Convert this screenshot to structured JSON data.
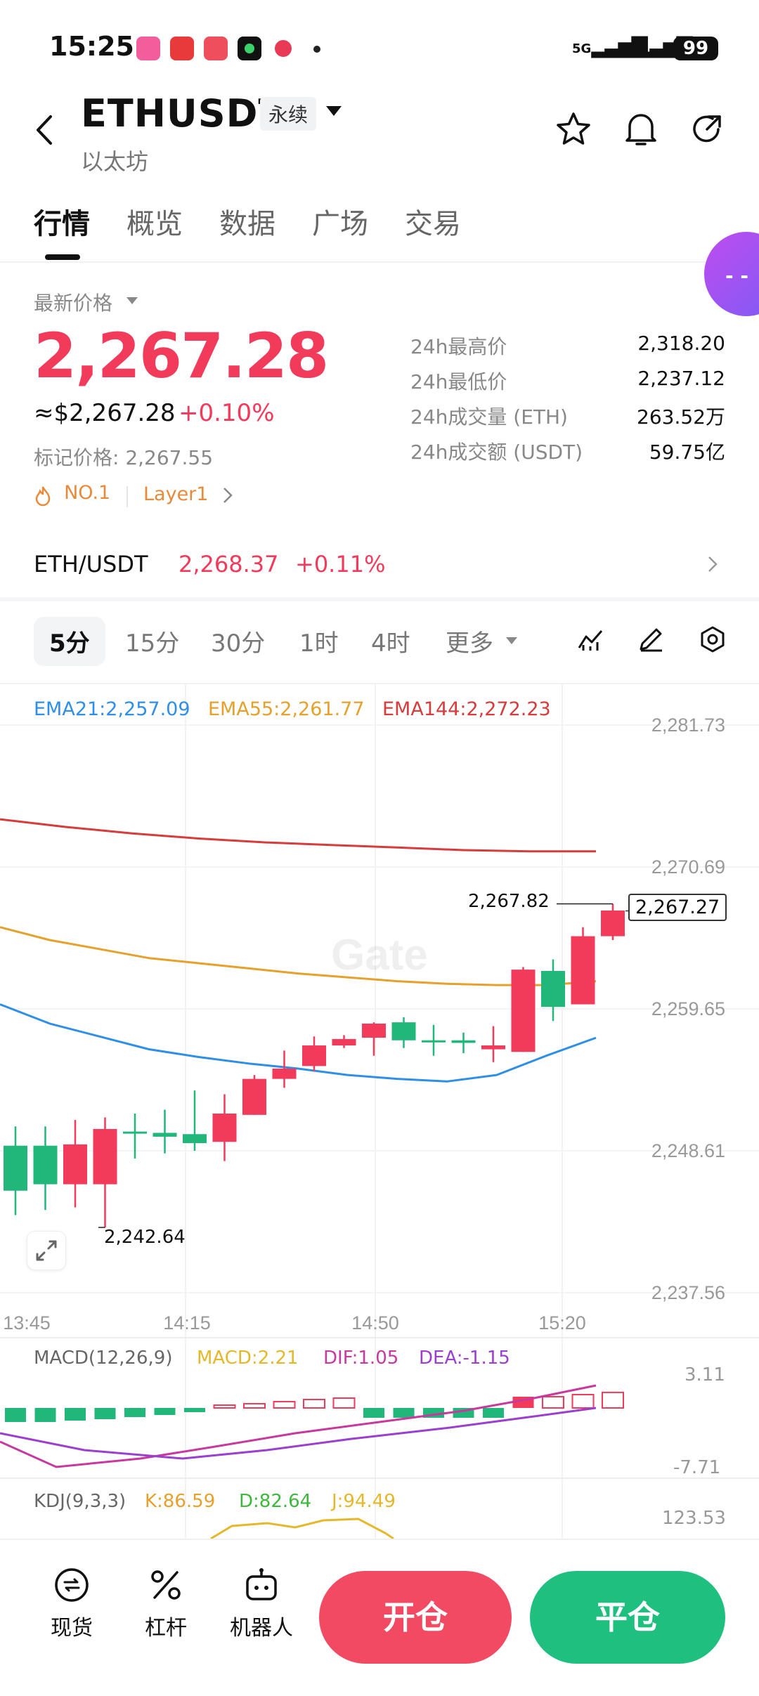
{
  "status": {
    "time": "15:25",
    "battery": "99",
    "net1": "5G",
    "net2": "5G"
  },
  "header": {
    "symbol": "ETHUSDT",
    "contract_type": "永续",
    "subtitle": "以太坊"
  },
  "tabs": [
    {
      "label": "行情",
      "active": true
    },
    {
      "label": "概览"
    },
    {
      "label": "数据"
    },
    {
      "label": "广场"
    },
    {
      "label": "交易"
    }
  ],
  "ticker": {
    "price_label": "最新价格",
    "last_price": "2,267.28",
    "usd_equiv": "≈$2,267.28",
    "change": "+0.10%",
    "mark_price": "标记价格: 2,267.55",
    "chip_rank": "NO.1",
    "chip_category": "Layer1",
    "stats": [
      {
        "label": "24h最高价",
        "value": "2,318.20"
      },
      {
        "label": "24h最低价",
        "value": "2,237.12"
      },
      {
        "label": "24h成交量 (ETH)",
        "value": "263.52万"
      },
      {
        "label": "24h成交额 (USDT)",
        "value": "59.75亿"
      }
    ]
  },
  "spot_pair": {
    "pair": "ETH/USDT",
    "price": "2,268.37",
    "change": "+0.11%"
  },
  "periods": [
    "5分",
    "15分",
    "30分",
    "1时",
    "4时"
  ],
  "periods_more": "更多",
  "active_period": "5分",
  "watermark": "Gate",
  "kline": {
    "ema21": "EMA21:2,257.09",
    "ema55": "EMA55:2,261.77",
    "ema144": "EMA144:2,272.23",
    "high_marker": "2,267.82",
    "low_marker": "2,242.64",
    "current_tag": "2,267.27",
    "colors": {
      "up": "#21b77a",
      "down": "#f23a5b",
      "ema21": "#2f8ee6",
      "ema55": "#e5a12b",
      "ema144": "#d63c3c"
    }
  },
  "macd": {
    "title": "MACD(12,26,9)",
    "macd": "MACD:2.21",
    "dif": "DIF:1.05",
    "dea": "DEA:-1.15",
    "ymax": "3.11",
    "ymin": "-7.71"
  },
  "kdj": {
    "title": "KDJ(9,3,3)",
    "k": "K:86.59",
    "d": "D:82.64",
    "j": "J:94.49",
    "ymax": "123.53"
  },
  "chart_data": {
    "type": "candlestick",
    "yticks": [
      "2,281.73",
      "2,270.69",
      "2,259.65",
      "2,248.61",
      "2,237.56"
    ],
    "xticks": [
      "13:45",
      "14:15",
      "14:50",
      "15:20"
    ],
    "candles": [
      {
        "o": 2245.5,
        "c": 2249.0,
        "h": 2250.5,
        "l": 2243.6
      },
      {
        "o": 2246.0,
        "c": 2249.0,
        "h": 2250.5,
        "l": 2244.0
      },
      {
        "o": 2249.1,
        "c": 2246.0,
        "h": 2251.0,
        "l": 2244.2
      },
      {
        "o": 2250.3,
        "c": 2246.0,
        "h": 2251.2,
        "l": 2242.64
      },
      {
        "o": 2250.0,
        "c": 2250.1,
        "h": 2251.5,
        "l": 2248.0
      },
      {
        "o": 2249.7,
        "c": 2250.0,
        "h": 2251.8,
        "l": 2248.4
      },
      {
        "o": 2249.2,
        "c": 2249.9,
        "h": 2253.3,
        "l": 2248.6
      },
      {
        "o": 2251.5,
        "c": 2249.3,
        "h": 2253.0,
        "l": 2247.8
      },
      {
        "o": 2254.2,
        "c": 2251.4,
        "h": 2254.5,
        "l": 2251.4
      },
      {
        "o": 2255.0,
        "c": 2254.2,
        "h": 2256.4,
        "l": 2253.5
      },
      {
        "o": 2256.8,
        "c": 2255.2,
        "h": 2257.5,
        "l": 2254.8
      },
      {
        "o": 2257.3,
        "c": 2256.8,
        "h": 2257.6,
        "l": 2256.6
      },
      {
        "o": 2258.5,
        "c": 2257.4,
        "h": 2258.6,
        "l": 2256.0
      },
      {
        "o": 2257.2,
        "c": 2258.6,
        "h": 2259.0,
        "l": 2256.6
      },
      {
        "o": 2257.2,
        "c": 2257.2,
        "h": 2258.4,
        "l": 2256.0
      },
      {
        "o": 2257.0,
        "c": 2257.2,
        "h": 2257.8,
        "l": 2256.2
      },
      {
        "o": 2256.8,
        "c": 2256.5,
        "h": 2258.3,
        "l": 2255.5
      },
      {
        "o": 2262.7,
        "c": 2256.3,
        "h": 2262.9,
        "l": 2256.3
      },
      {
        "o": 2259.8,
        "c": 2262.6,
        "h": 2263.5,
        "l": 2258.7
      },
      {
        "o": 2265.3,
        "c": 2260.0,
        "h": 2266.0,
        "l": 2260.0
      },
      {
        "o": 2267.3,
        "c": 2265.3,
        "h": 2267.82,
        "l": 2265.0
      }
    ],
    "ema21": [
      2260.0,
      2258.5,
      2257.5,
      2256.5,
      2255.9,
      2255.4,
      2255.0,
      2254.5,
      2254.2,
      2254.0,
      2254.5,
      2256.0,
      2257.4
    ],
    "ema55": [
      2266.0,
      2265.0,
      2264.3,
      2263.6,
      2263.2,
      2262.8,
      2262.4,
      2262.1,
      2261.8,
      2261.6,
      2261.5,
      2261.5,
      2261.8
    ],
    "ema144": [
      2274.4,
      2273.8,
      2273.3,
      2272.9,
      2272.6,
      2272.4,
      2272.2,
      2272.0,
      2271.9,
      2271.9
    ],
    "macd_hist": [
      -2.0,
      -2.0,
      -1.8,
      -1.6,
      -1.3,
      -1.0,
      -0.6,
      0.4,
      0.6,
      0.9,
      1.2,
      1.4,
      -1.4,
      -1.4,
      -1.4,
      -1.4,
      -1.4,
      1.6,
      1.6,
      1.9,
      2.21
    ]
  }
}
